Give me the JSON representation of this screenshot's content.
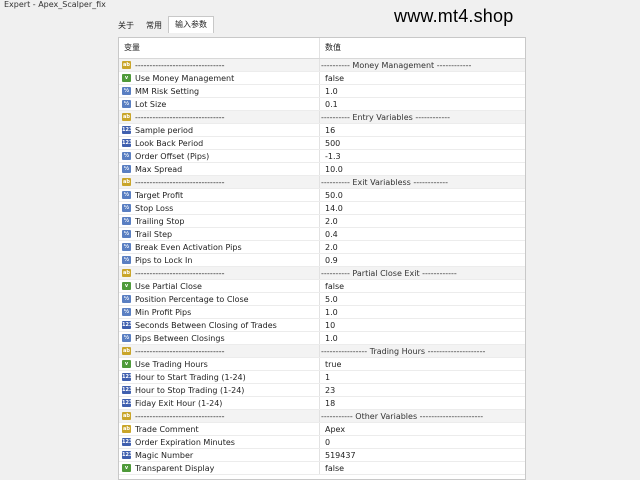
{
  "window": {
    "title": "Expert - Apex_Scalper_fix"
  },
  "watermark": "www.mt4.shop",
  "tabs": [
    {
      "label": "关于",
      "active": false
    },
    {
      "label": "常用",
      "active": false
    },
    {
      "label": "输入参数",
      "active": true
    }
  ],
  "table": {
    "col_variable": "变量",
    "col_value": "数值",
    "rows": [
      {
        "type": "ab",
        "name": "-------------------------------",
        "value": "---------- Money Management ------------"
      },
      {
        "type": "bool",
        "name": "Use Money Management",
        "value": "false"
      },
      {
        "type": "dbl",
        "name": "MM Risk Setting",
        "value": "1.0"
      },
      {
        "type": "dbl",
        "name": "Lot Size",
        "value": "0.1"
      },
      {
        "type": "ab",
        "name": "-------------------------------",
        "value": "---------- Entry Variables ------------"
      },
      {
        "type": "int",
        "name": "Sample period",
        "value": "16"
      },
      {
        "type": "int",
        "name": "Look Back Period",
        "value": "500"
      },
      {
        "type": "dbl",
        "name": "Order Offset (Pips)",
        "value": "-1.3"
      },
      {
        "type": "dbl",
        "name": "Max Spread",
        "value": "10.0"
      },
      {
        "type": "ab",
        "name": "-------------------------------",
        "value": "---------- Exit Variabless ------------"
      },
      {
        "type": "dbl",
        "name": "Target Profit",
        "value": "50.0"
      },
      {
        "type": "dbl",
        "name": "Stop Loss",
        "value": "14.0"
      },
      {
        "type": "dbl",
        "name": "Trailing Stop",
        "value": "2.0"
      },
      {
        "type": "dbl",
        "name": "Trail Step",
        "value": "0.4"
      },
      {
        "type": "dbl",
        "name": "Break Even Activation Pips",
        "value": "2.0"
      },
      {
        "type": "dbl",
        "name": "Pips to Lock In",
        "value": "0.9"
      },
      {
        "type": "ab",
        "name": "-------------------------------",
        "value": "---------- Partial Close Exit ------------"
      },
      {
        "type": "bool",
        "name": "Use Partial Close",
        "value": "false"
      },
      {
        "type": "dbl",
        "name": "Position Percentage to Close",
        "value": "5.0"
      },
      {
        "type": "dbl",
        "name": "Min Profit Pips",
        "value": "1.0"
      },
      {
        "type": "int",
        "name": "Seconds Between Closing of Trades",
        "value": "10"
      },
      {
        "type": "dbl",
        "name": "Pips Between Closings",
        "value": "1.0"
      },
      {
        "type": "ab",
        "name": "-------------------------------",
        "value": "---------------- Trading Hours --------------------"
      },
      {
        "type": "bool",
        "name": "Use Trading Hours",
        "value": "true"
      },
      {
        "type": "int",
        "name": "Hour to Start Trading (1-24)",
        "value": "1"
      },
      {
        "type": "int",
        "name": "Hour to Stop Trading (1-24)",
        "value": "23"
      },
      {
        "type": "int",
        "name": "Fiday Exit Hour (1-24)",
        "value": "18"
      },
      {
        "type": "ab",
        "name": "-------------------------------",
        "value": "----------- Other Variables ----------------------"
      },
      {
        "type": "ab",
        "name": "Trade Comment",
        "value": " Apex"
      },
      {
        "type": "int",
        "name": "Order Expiration Minutes",
        "value": "0"
      },
      {
        "type": "int",
        "name": "Magic Number",
        "value": "519437"
      },
      {
        "type": "bool",
        "name": "Transparent Display",
        "value": "false"
      }
    ]
  },
  "icons": {
    "ab": "ab",
    "bool": "v",
    "dbl": "½",
    "int": "123"
  },
  "colors": {
    "ab": "#c9a52a",
    "bool": "#4f9a3a",
    "dbl": "#5a7fc2",
    "int": "#3f5fae"
  }
}
